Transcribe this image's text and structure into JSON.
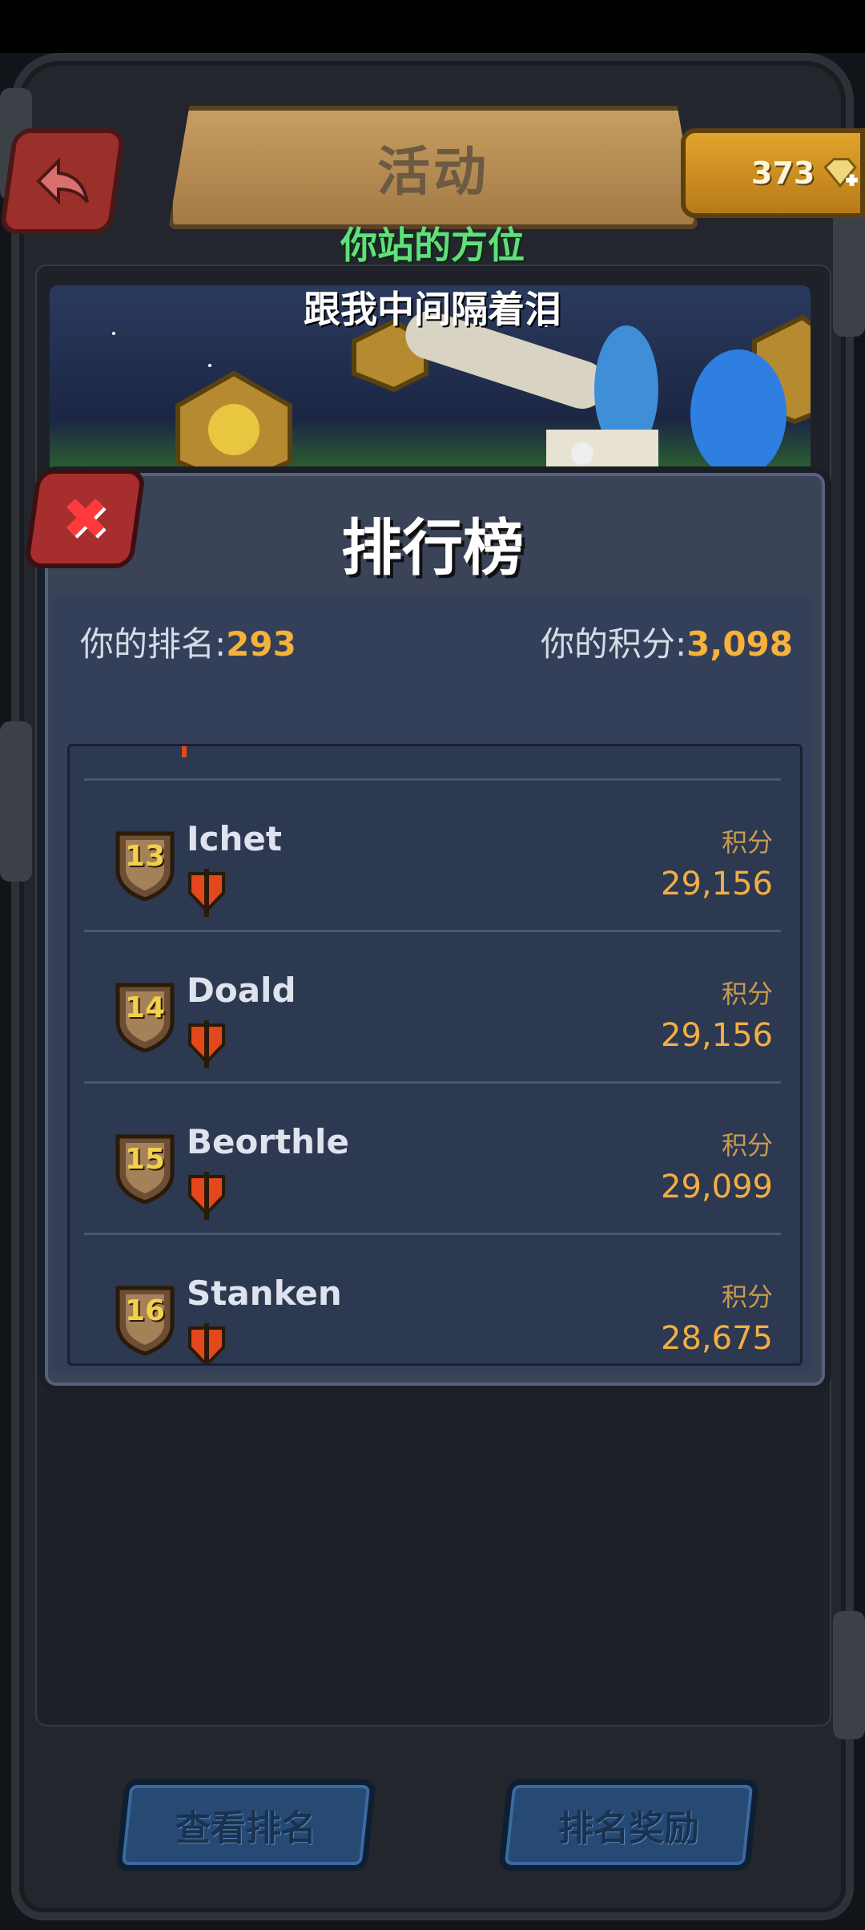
{
  "header": {
    "title": "活动",
    "gem_count": "373"
  },
  "subtitles": {
    "line1": "你站的方位",
    "line2": "跟我中间隔着泪"
  },
  "leaderboard": {
    "title": "排行榜",
    "my_rank_label": "你的排名:",
    "my_rank_value": "293",
    "my_score_label": "你的积分:",
    "my_score_value": "3,098",
    "score_label": "积分",
    "rows": [
      {
        "rank": "13",
        "name": "Ichet",
        "score": "29,156"
      },
      {
        "rank": "14",
        "name": "Doald",
        "score": "29,156"
      },
      {
        "rank": "15",
        "name": "Beorthle",
        "score": "29,099"
      },
      {
        "rank": "16",
        "name": "Stanken",
        "score": "28,675"
      }
    ]
  },
  "buttons": {
    "view_rank": "查看排名",
    "rank_rewards": "排名奖励"
  },
  "colors": {
    "accent_gold": "#f6b23a",
    "subtitle_green": "#5fe07a",
    "panel": "#3a4358"
  }
}
